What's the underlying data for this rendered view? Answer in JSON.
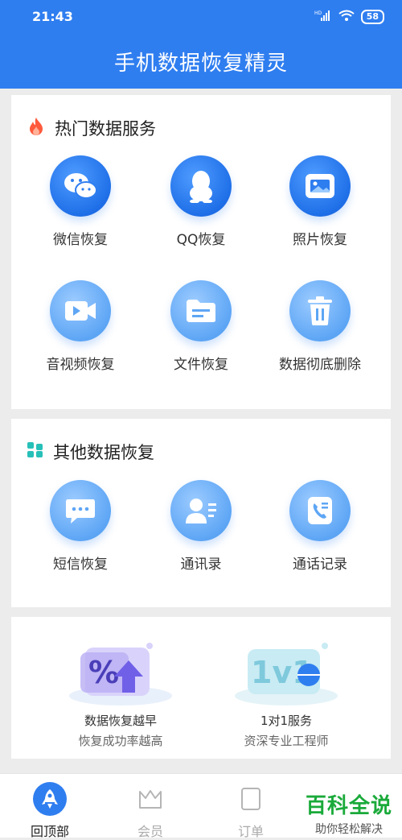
{
  "status_bar": {
    "time": "21:43",
    "battery": "58",
    "signal": "HD"
  },
  "header": {
    "title": "手机数据恢复精灵"
  },
  "hot_section": {
    "title": "热门数据服务",
    "icon": "fire-icon",
    "items": [
      {
        "label": "微信恢复",
        "icon": "wechat-icon"
      },
      {
        "label": "QQ恢复",
        "icon": "qq-penguin-icon"
      },
      {
        "label": "照片恢复",
        "icon": "photo-icon"
      },
      {
        "label": "音视频恢复",
        "icon": "video-icon"
      },
      {
        "label": "文件恢复",
        "icon": "file-icon"
      },
      {
        "label": "数据彻底删除",
        "icon": "trash-icon"
      }
    ]
  },
  "other_section": {
    "title": "其他数据恢复",
    "icon": "grid-icon",
    "items": [
      {
        "label": "短信恢复",
        "icon": "sms-icon"
      },
      {
        "label": "通讯录",
        "icon": "contacts-icon"
      },
      {
        "label": "通话记录",
        "icon": "call-log-icon"
      }
    ]
  },
  "promos": [
    {
      "graphic_text": "%",
      "line1": "数据恢复越早",
      "line2": "恢复成功率越高"
    },
    {
      "graphic_text": "1v1",
      "line1": "1对1服务",
      "line2": "资深专业工程师"
    }
  ],
  "bottom_nav": [
    {
      "label": "回顶部",
      "icon": "rocket-icon",
      "active": true
    },
    {
      "label": "会员",
      "icon": "crown-icon",
      "active": false
    },
    {
      "label": "订单",
      "icon": "order-icon",
      "active": false
    }
  ],
  "watermark": {
    "big": "百科全说",
    "small": "助你轻松解决"
  },
  "colors": {
    "primary": "#2f7ef0",
    "fire": "#ff5a3c",
    "grid": "#27c0b8",
    "watermark": "#1aaa3a"
  }
}
